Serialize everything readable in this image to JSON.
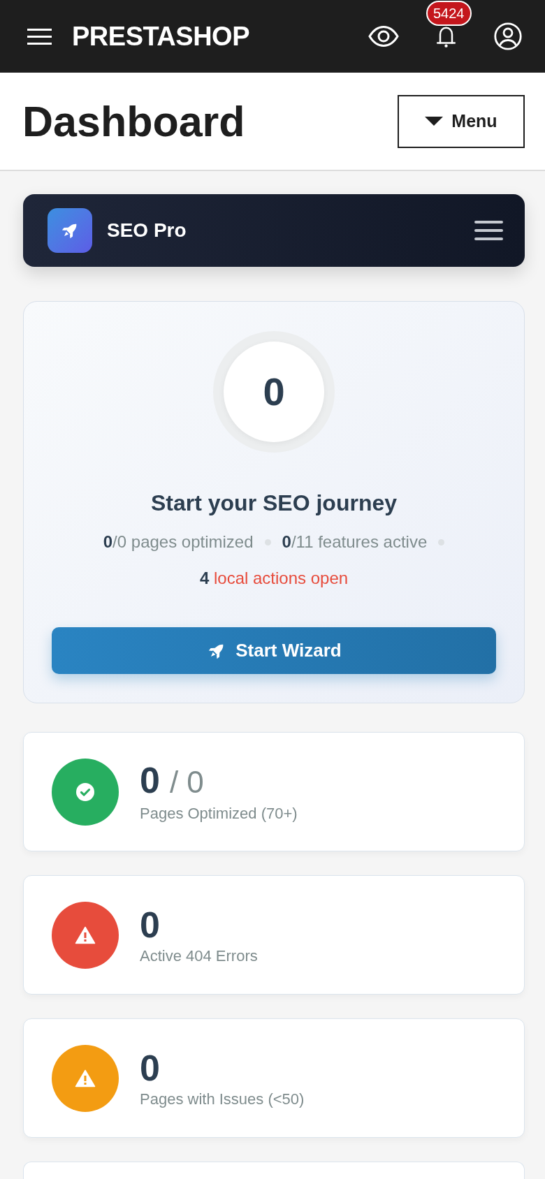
{
  "top_bar": {
    "logo": "PRESTASHOP",
    "notification_count": "5424"
  },
  "page_header": {
    "title": "Dashboard",
    "menu_button": "Menu"
  },
  "module_bar": {
    "title": "SEO Pro"
  },
  "score_card": {
    "score": "0",
    "heading": "Start your SEO journey",
    "stats": [
      {
        "kind": "count",
        "text": "**0**/0 pages optimized"
      },
      {
        "kind": "count",
        "text": "**0**/11 features active"
      },
      {
        "kind": "alert",
        "text": "**4** local actions open"
      }
    ],
    "button": "Start Wizard"
  },
  "stat_cards": [
    {
      "kind": "check",
      "color": "#27ae60",
      "value": "0",
      "total": "/ 0",
      "label": "Pages Optimized (70+)"
    },
    {
      "kind": "warning",
      "color": "#e74c3c",
      "value": "0",
      "label": "Active 404 Errors"
    },
    {
      "kind": "warning",
      "color": "#f39c12",
      "value": "0",
      "label": "Pages with Issues (<50)"
    }
  ]
}
